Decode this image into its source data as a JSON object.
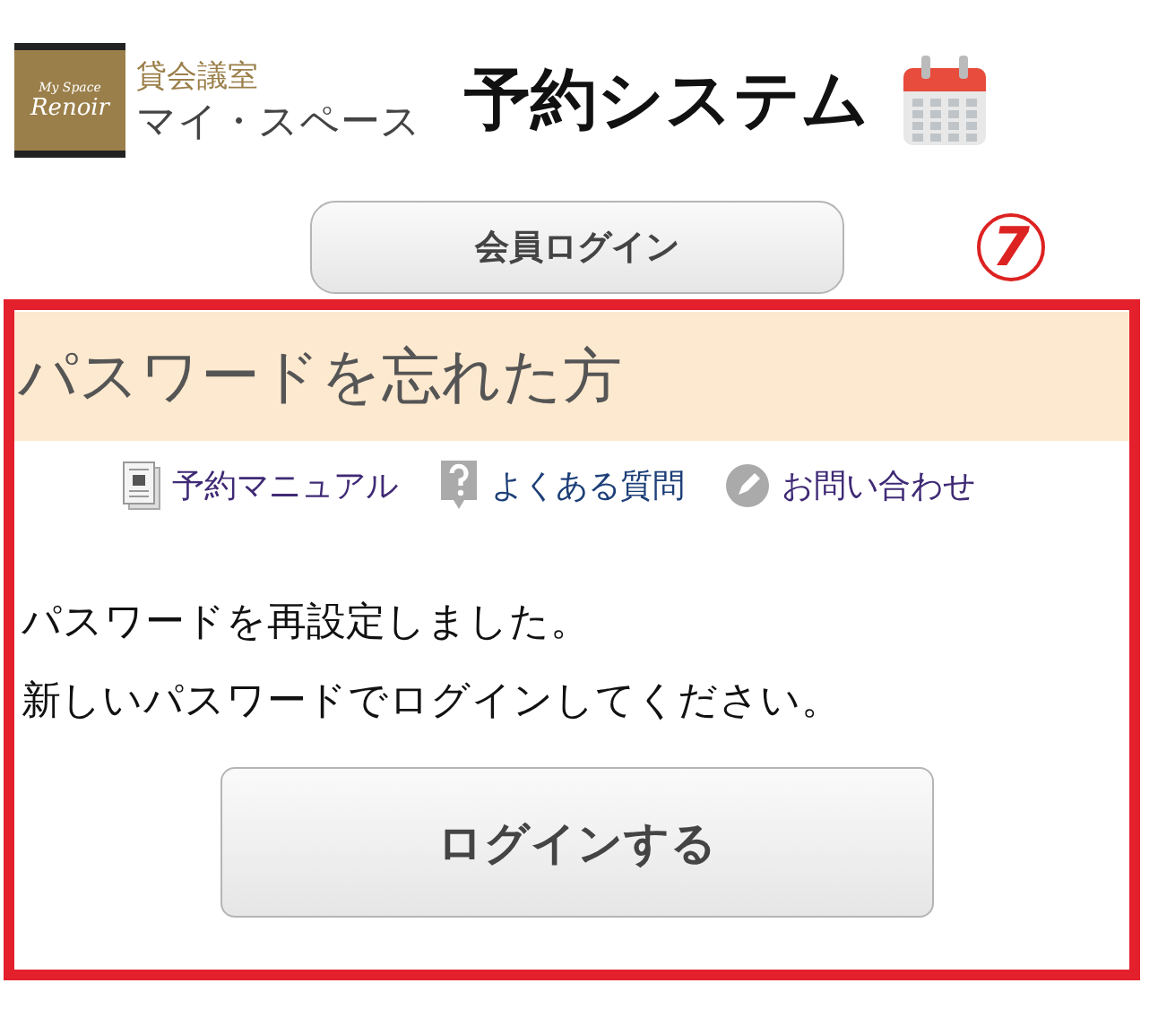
{
  "logo": {
    "tagline": "My Space",
    "brand": "Renoir",
    "category": "貸会議室",
    "name": "マイ・スペース"
  },
  "title": "予約システム",
  "login_button": "会員ログイン",
  "step_marker": "7",
  "panel": {
    "heading": "パスワードを忘れた方",
    "links": [
      {
        "kind": "manual",
        "label": "予約マニュアル"
      },
      {
        "kind": "faq",
        "label": "よくある質問"
      },
      {
        "kind": "contact",
        "label": "お問い合わせ"
      }
    ],
    "message": [
      "パスワードを再設定しました。",
      "新しいパスワードでログインしてください。"
    ],
    "button": "ログインする"
  }
}
